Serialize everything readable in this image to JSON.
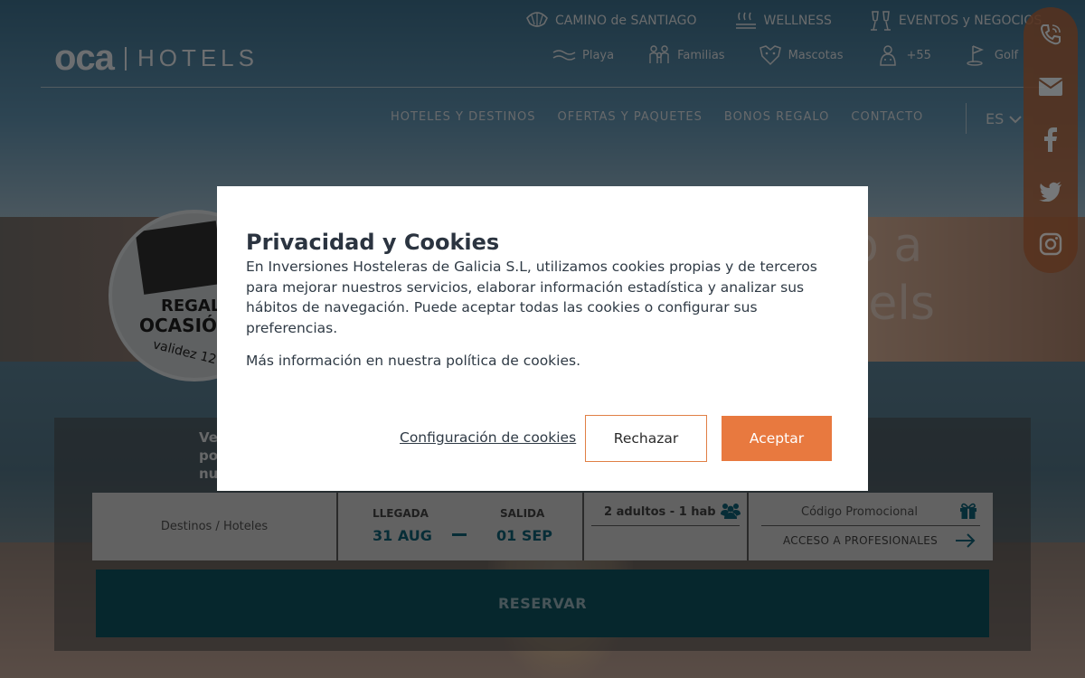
{
  "brand": {
    "logo_main": "oca",
    "logo_sub": "HOTELS"
  },
  "top_nav_row1": [
    {
      "label": "CAMINO de SANTIAGO",
      "icon": "shell-icon"
    },
    {
      "label": "WELLNESS",
      "icon": "steam-icon"
    },
    {
      "label": "EVENTOS y NEGOCIOS",
      "icon": "glasses-toast-icon"
    }
  ],
  "top_nav_row2": [
    {
      "label": "Playa",
      "icon": "waves-icon"
    },
    {
      "label": "Familias",
      "icon": "family-icon"
    },
    {
      "label": "Mascotas",
      "icon": "pet-icon"
    },
    {
      "label": "+55",
      "icon": "senior-icon"
    },
    {
      "label": "Golf",
      "icon": "golf-icon"
    }
  ],
  "main_nav": [
    "HOTELES Y DESTINOS",
    "OFERTAS Y PAQUETES",
    "BONOS REGALO",
    "CONTACTO"
  ],
  "language": {
    "current": "ES"
  },
  "social": [
    "phone-icon",
    "email-icon",
    "facebook-icon",
    "twitter-icon",
    "instagram-icon"
  ],
  "hero": {
    "line1": "o a",
    "line2": "tels"
  },
  "badge": {
    "line1": "REGAL",
    "line2": "OCASIÓ",
    "line3": "validez 12 m"
  },
  "booking": {
    "promo_lines": [
      "Ve",
      "po",
      "nu"
    ],
    "destination_label": "Destinos / Hoteles",
    "arrival_label": "LLEGADA",
    "arrival_value": "31 AUG",
    "departure_label": "SALIDA",
    "departure_value": "01 SEP",
    "guests_value": "2 adultos - 1 hab",
    "promo_code_label": "Código Promocional",
    "professionals_label": "ACCESO A PROFESIONALES",
    "reserve_label": "RESERVAR"
  },
  "cookie_modal": {
    "title": "Privacidad y Cookies",
    "body": "En Inversiones Hosteleras de Galicia S.L, utilizamos cookies propias y de terceros para mejorar nuestros servicios, elaborar información estadística y analizar sus hábitos de navegación. Puede aceptar todas las cookies o configurar sus preferencias.",
    "more_info": "Más información en nuestra política de cookies.",
    "config_label": "Configuración de cookies",
    "reject_label": "Rechazar",
    "accept_label": "Aceptar"
  },
  "colors": {
    "accent": "#e8793f",
    "reserve_bg": "#0c4f5b",
    "date_text": "#0f5b6f",
    "social_bg": "#b0643b"
  }
}
